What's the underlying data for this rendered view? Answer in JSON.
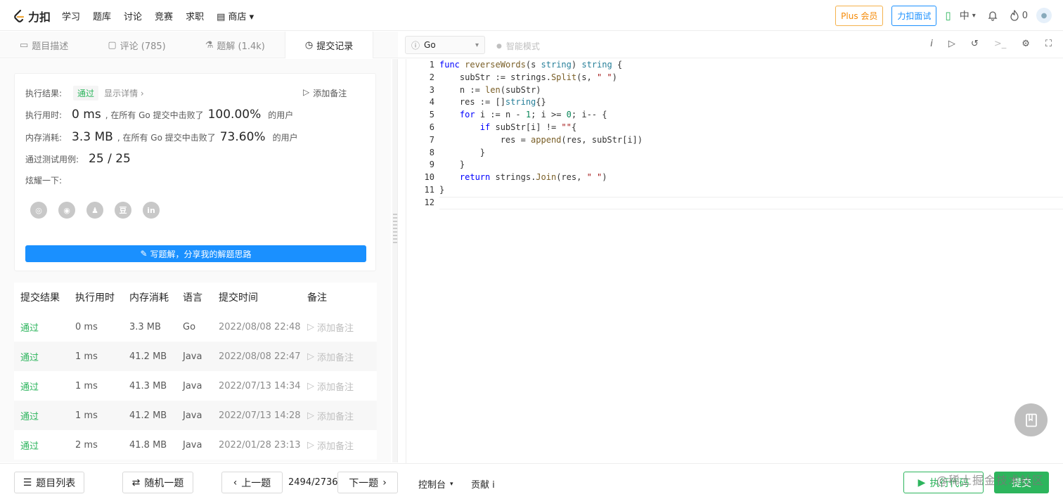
{
  "nav": {
    "logo_text": "力扣",
    "links": [
      "学习",
      "题库",
      "讨论",
      "竞赛",
      "求职"
    ],
    "shop_label": "商店",
    "plus_label": "Plus 会员",
    "mianshi_label": "力扣面试",
    "lang_label": "中",
    "fire_count": "0"
  },
  "tabs": [
    {
      "label": "题目描述"
    },
    {
      "label": "评论 (785)"
    },
    {
      "label": "题解 (1.4k)"
    },
    {
      "label": "提交记录"
    }
  ],
  "result": {
    "label": "执行结果:",
    "status": "通过",
    "details_link": "显示详情 ›",
    "add_note": "添加备注",
    "time_label": "执行用时:",
    "time_value": "0 ms",
    "time_desc": ", 在所有 Go 提交中击败了",
    "time_pct": "100.00%",
    "time_suffix": "的用户",
    "mem_label": "内存消耗:",
    "mem_value": "3.3 MB",
    "mem_desc": ", 在所有 Go 提交中击败了",
    "mem_pct": "73.60%",
    "mem_suffix": "的用户",
    "tests_label": "通过测试用例:",
    "tests_value": "25 / 25",
    "share_label": "炫耀一下:",
    "share_icons": [
      "wechat-icon",
      "weibo-icon",
      "qq-icon",
      "douban-icon",
      "linkedin-icon"
    ],
    "write_btn": "写题解，分享我的解题思路"
  },
  "submissions": {
    "headers": [
      "提交结果",
      "执行用时",
      "内存消耗",
      "语言",
      "提交时间",
      "备注"
    ],
    "rows": [
      {
        "status": "通过",
        "time": "0 ms",
        "mem": "3.3 MB",
        "lang": "Go",
        "date": "2022/08/08 22:48",
        "note": "添加备注"
      },
      {
        "status": "通过",
        "time": "1 ms",
        "mem": "41.2 MB",
        "lang": "Java",
        "date": "2022/08/08 22:47",
        "note": "添加备注"
      },
      {
        "status": "通过",
        "time": "1 ms",
        "mem": "41.3 MB",
        "lang": "Java",
        "date": "2022/07/13 14:34",
        "note": "添加备注"
      },
      {
        "status": "通过",
        "time": "1 ms",
        "mem": "41.2 MB",
        "lang": "Java",
        "date": "2022/07/13 14:28",
        "note": "添加备注"
      },
      {
        "status": "通过",
        "time": "2 ms",
        "mem": "41.8 MB",
        "lang": "Java",
        "date": "2022/01/28 23:13",
        "note": "添加备注"
      }
    ]
  },
  "editor": {
    "language": "Go",
    "smart_mode": "智能模式",
    "line_numbers": [
      "1",
      "2",
      "3",
      "4",
      "5",
      "6",
      "7",
      "8",
      "9",
      "10",
      "11",
      "12"
    ]
  },
  "bottom": {
    "list_btn": "题目列表",
    "random_btn": "随机一题",
    "prev_btn": "上一题",
    "page": "2494/2736",
    "next_btn": "下一题",
    "console": "控制台",
    "contribute": "贡献 i",
    "run_btn": "执行代码",
    "submit_btn": "提交"
  },
  "watermark": "@稀土掘金技术社区",
  "colors": {
    "accent": "#1a90ff",
    "success": "#2db55d",
    "shop": "#f58a07"
  }
}
